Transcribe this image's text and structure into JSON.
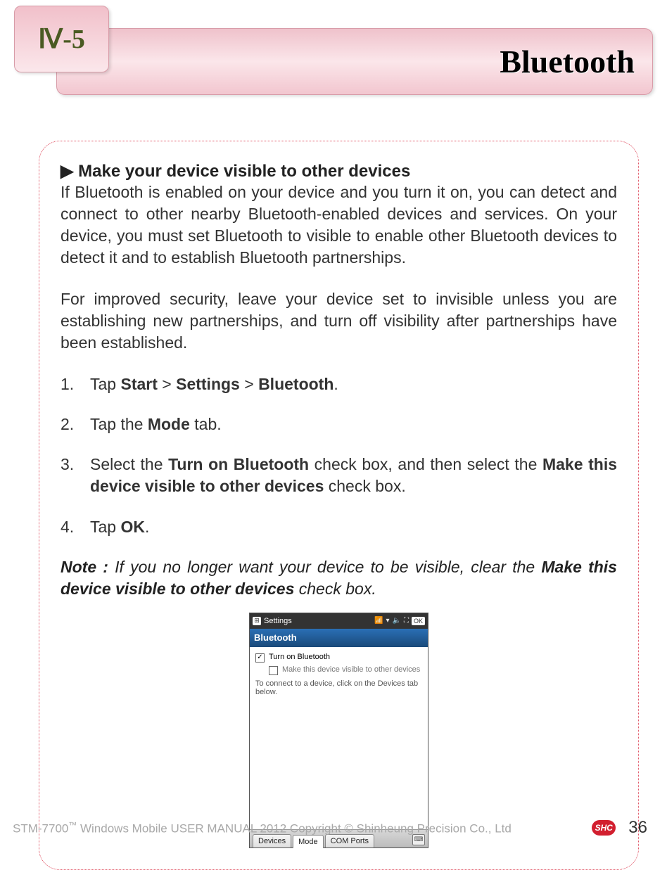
{
  "header": {
    "section_number": "Ⅳ-5",
    "title": "Bluetooth"
  },
  "content": {
    "heading": "▶ Make your device visible to other devices",
    "para1": "If Bluetooth is enabled on your device and you turn it on, you can detect and connect to other nearby Bluetooth-enabled devices and services. On your device, you must set Bluetooth to visible to enable other Bluetooth devices to detect it and to establish Bluetooth partnerships.",
    "para2": "For improved security, leave your device set to invisible unless you are establishing new partnerships, and turn off visibility after partnerships have been established.",
    "steps": {
      "s1_a": "Tap ",
      "s1_b": "Start",
      "s1_c": " > ",
      "s1_d": "Settings",
      "s1_e": " > ",
      "s1_f": "Bluetooth",
      "s1_g": ".",
      "s2_a": "Tap the ",
      "s2_b": "Mode",
      "s2_c": " tab.",
      "s3_a": "Select the ",
      "s3_b": "Turn on Bluetooth",
      "s3_c": " check box, and then select the ",
      "s3_d": "Make this device visible to other devices",
      "s3_e": " check box.",
      "s4_a": "Tap ",
      "s4_b": "OK",
      "s4_c": "."
    },
    "note": {
      "label": "Note :",
      "a": " If you no longer want your device to be visible, clear the ",
      "b": "Make this device visible to other devices",
      "c": " check box."
    }
  },
  "screenshot": {
    "topbar_title": "Settings",
    "ok": "OK",
    "subtitle": "Bluetooth",
    "check1": "Turn on Bluetooth",
    "check1_checked": "✓",
    "check2": "Make this device visible to other devices",
    "hint": "To connect to a device, click on the Devices tab below.",
    "tabs": {
      "devices": "Devices",
      "mode": "Mode",
      "com": "COM Ports"
    }
  },
  "footer": {
    "copy_a": "STM-7700",
    "copy_tm": "™",
    "copy_b": " Windows Mobile USER MANUAL  2012 Copyright © Shinheung Precision Co., Ltd",
    "logo": "SHC",
    "page": "36"
  }
}
